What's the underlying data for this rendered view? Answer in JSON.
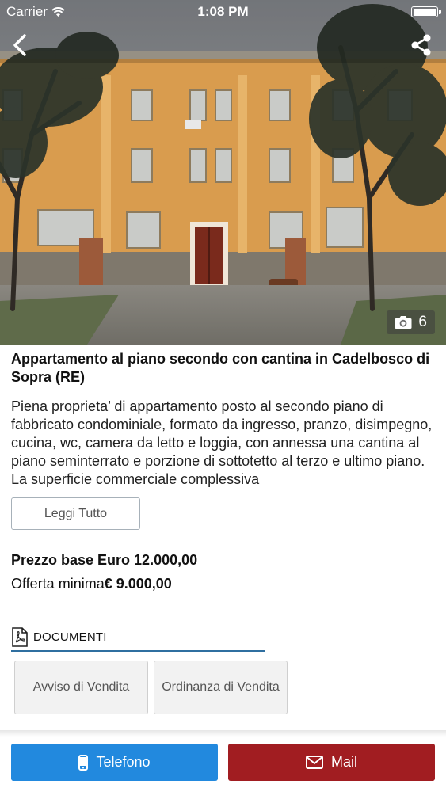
{
  "status_bar": {
    "carrier": "Carrier",
    "time": "1:08 PM"
  },
  "hero": {
    "photo_count": "6",
    "icons": [
      "back-arrow-icon",
      "share-icon",
      "camera-icon"
    ]
  },
  "listing": {
    "title": "Appartamento al piano secondo con cantina in Cadelbosco di Sopra (RE)",
    "description": "Piena proprieta’ di appartamento posto al secondo piano di fabbricato condominiale, formato da ingresso, pranzo, disimpegno, cucina, wc, camera da letto e loggia, con annessa una cantina al piano seminterrato e porzione di sottotetto al terzo e ultimo piano. La superficie commerciale complessiva",
    "read_more_label": "Leggi Tutto",
    "price_base": "Prezzo base Euro 12.000,00",
    "min_offer_label": "Offerta minima",
    "min_offer_value": "€ 9.000,00"
  },
  "documents": {
    "header": "DOCUMENTI",
    "items": [
      {
        "label": "Avviso di Vendita"
      },
      {
        "label": "Ordinanza di Vendita"
      }
    ]
  },
  "actions": {
    "phone_label": "Telefono",
    "mail_label": "Mail"
  },
  "colors": {
    "phone_button": "#2289de",
    "mail_button": "#a11d21",
    "docs_underline": "#2f6fa0"
  }
}
